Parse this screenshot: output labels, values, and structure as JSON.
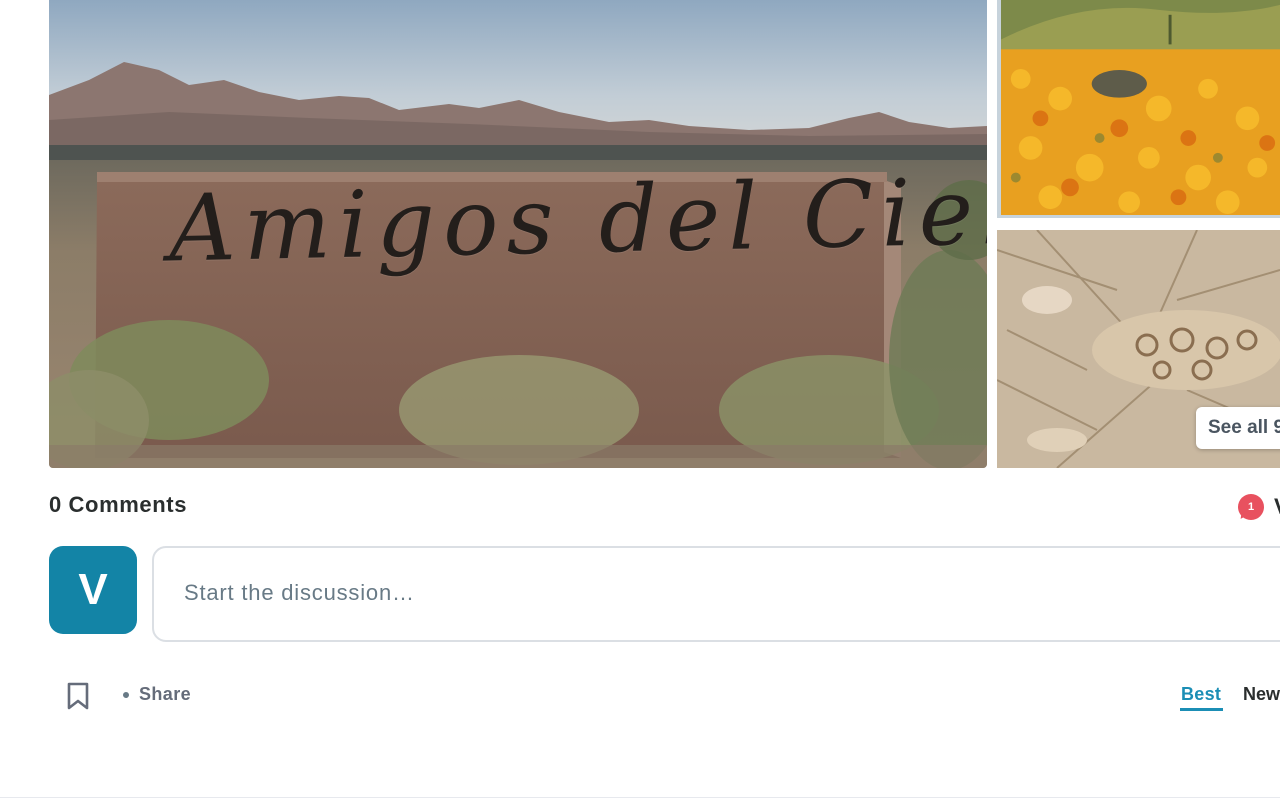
{
  "gallery": {
    "sign_text": "Amigos del Cielo",
    "see_all_label": "See all 9"
  },
  "comments": {
    "count_label": "0 Comments",
    "notification_count": "1",
    "notification_user_initial": "V",
    "avatar_initial": "V",
    "composer_placeholder": "Start the discussion…"
  },
  "toolbar": {
    "share_label": "Share",
    "sort_options": [
      "Best",
      "Newest"
    ],
    "active_sort": "Best"
  },
  "colors": {
    "avatar_bg": "#1384a6",
    "accent": "#1b8eb5",
    "notification": "#e8515f"
  },
  "icons": [
    "bookmark-icon",
    "notification-bubble-icon"
  ]
}
